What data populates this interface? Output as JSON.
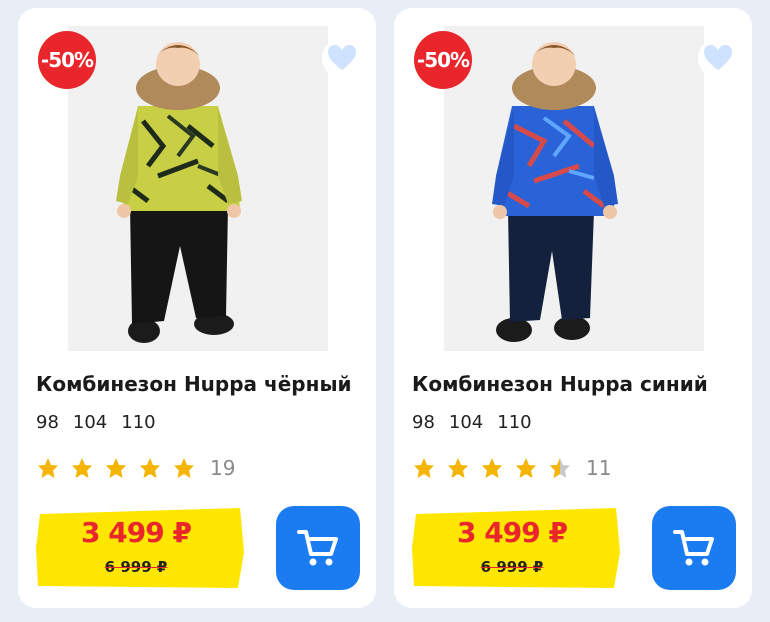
{
  "products": [
    {
      "title": "Комбинезон Huppa чёрный",
      "discount_badge": "-50%",
      "sizes": [
        "98",
        "104",
        "110"
      ],
      "rating_stars": 5,
      "rating_count": "19",
      "price": "3 499 ₽",
      "old_price": "6 999 ₽",
      "jacket_color": "#c8cf45",
      "pants_color": "#151515"
    },
    {
      "title": "Комбинезон Huppa синий",
      "discount_badge": "-50%",
      "sizes": [
        "98",
        "104",
        "110"
      ],
      "rating_stars": 4.5,
      "rating_count": "11",
      "price": "3 499 ₽",
      "old_price": "6 999 ₽",
      "jacket_color": "#2a63d8",
      "pants_color": "#14213d"
    }
  ],
  "icons": {
    "favorite": "heart-icon",
    "cart": "cart-icon",
    "rating": "star-icon"
  },
  "colors": {
    "accent_red": "#e8262b",
    "price_bg": "#ffe600",
    "cart_blue": "#1a7cf0",
    "star": "#f5b400"
  }
}
